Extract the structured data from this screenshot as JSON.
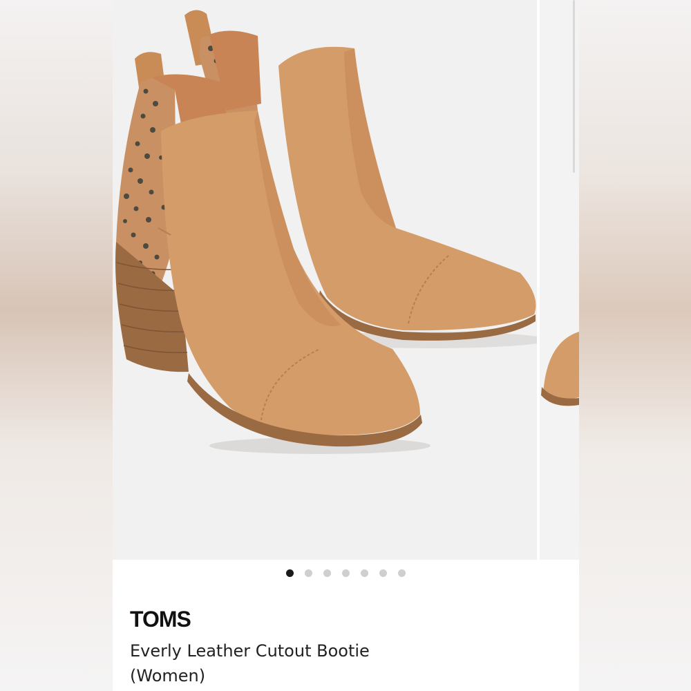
{
  "product": {
    "brand": "TOMS",
    "title": "Everly Leather Cutout Bootie (Women)"
  },
  "carousel": {
    "image_count": 7,
    "active_index": 0,
    "image_alt": "boots-product-photo"
  },
  "colors": {
    "leather": "#d39a67",
    "heel": "#9a6a43",
    "spots": "#4d4a40",
    "background": "#f1f1f1",
    "active_dot": "#1a1a1a",
    "inactive_dot": "#cfcfcf"
  }
}
